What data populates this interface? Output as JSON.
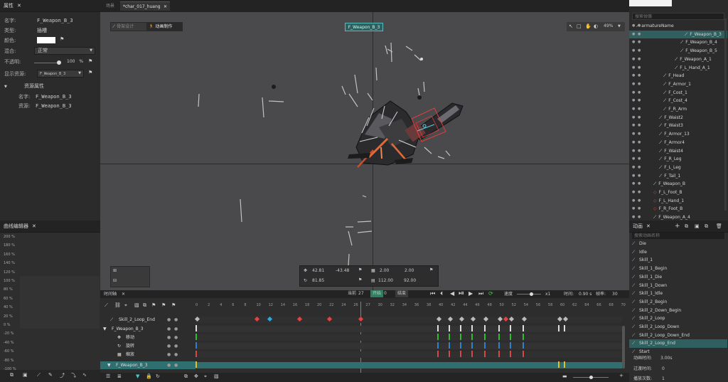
{
  "properties_panel": {
    "title": "属性",
    "name_label": "名字:",
    "name_value": "F_Weapon_B_3",
    "type_label": "类型:",
    "type_value": "插槽",
    "color_label": "颜色:",
    "blend_label": "混合:",
    "blend_value": "正常",
    "opacity_label": "不透明:",
    "opacity_value": "100",
    "opacity_unit": "%",
    "display_label": "显示资源:",
    "display_value": "F_Weapon_B_3",
    "resource_section": "资源属性",
    "res_name_label": "名字:",
    "res_name_value": "F_Weapon_B_3",
    "res_res_label": "资源:",
    "res_res_value": "F_Weapon_B_3"
  },
  "curve_panel": {
    "title": "曲线编辑器",
    "y_labels": [
      "200 %",
      "180 %",
      "160 %",
      "140 %",
      "120 %",
      "100 %",
      "80 %",
      "60 %",
      "40 %",
      "20 %",
      "0 %",
      "-20 %",
      "-40 %",
      "-60 %",
      "-80 %",
      "-100 %"
    ]
  },
  "tabs": {
    "left_tab": "场景",
    "active_tab": "*char_017_huang"
  },
  "viewport": {
    "mode_armature": "骨架设计",
    "mode_animate": "动画制作",
    "selected_label": "F_Weapon_B_3",
    "zoom": "49%",
    "pos_x": "42.81",
    "pos_y": "-43.48",
    "rot": "81.85",
    "scale_x": "2.00",
    "scale_y": "2.00",
    "size_w": "112.00",
    "size_h": "92.00"
  },
  "scene_tree": {
    "search_placeholder": "搜索骨骼",
    "items": [
      {
        "name": "armatureName",
        "indent": 10
      },
      {
        "name": "F_Weapon_B_3",
        "indent": 78,
        "selected": true
      },
      {
        "name": "F_Weapon_B_4",
        "indent": 72
      },
      {
        "name": "F_Weapon_B_5",
        "indent": 72
      },
      {
        "name": "F_Weapon_A_1",
        "indent": 64
      },
      {
        "name": "F_L_Hand_A_1",
        "indent": 64
      },
      {
        "name": "F_Head",
        "indent": 48
      },
      {
        "name": "F_Armor_1",
        "indent": 48
      },
      {
        "name": "F_Cost_1",
        "indent": 48
      },
      {
        "name": "F_Cost_4",
        "indent": 48
      },
      {
        "name": "F_R_Arm",
        "indent": 48
      },
      {
        "name": "F_Waist2",
        "indent": 42
      },
      {
        "name": "F_Waist3",
        "indent": 42
      },
      {
        "name": "F_Armor_13",
        "indent": 42
      },
      {
        "name": "F_Armor4",
        "indent": 42
      },
      {
        "name": "F_Waist4",
        "indent": 42
      },
      {
        "name": "F_R_Leg",
        "indent": 42
      },
      {
        "name": "F_L_Leg",
        "indent": 42
      },
      {
        "name": "F_Tail_1",
        "indent": 42
      },
      {
        "name": "F_Weapon_B",
        "indent": 34
      },
      {
        "name": "F_L_Foot_B",
        "indent": 34,
        "red": true
      },
      {
        "name": "F_L_Hand_1",
        "indent": 34,
        "red": true
      },
      {
        "name": "F_R_Foot_B",
        "indent": 34,
        "red": true
      },
      {
        "name": "F_Weapon_A_4",
        "indent": 34
      }
    ]
  },
  "animation_panel": {
    "title": "动画",
    "search_placeholder": "搜索动画名称",
    "items": [
      "Die",
      "Idle",
      "Skill_1",
      "Skill_1_Begin",
      "Skill_1_Die",
      "Skill_1_Down",
      "Skill_1_Idle",
      "Skill_2_Begin",
      "Skill_2_Down_Begin",
      "Skill_2_Loop",
      "Skill_2_Loop_Down",
      "Skill_2_Loop_Down_End",
      "Skill_2_Loop_End",
      "Start"
    ],
    "selected": "Skill_2_Loop_End",
    "duration_label": "动画时间:",
    "duration_value": "3.00s",
    "transition_label": "过渡时间:",
    "transition_value": "0",
    "loop_label": "播放次数:",
    "loop_value": "1"
  },
  "timeline": {
    "title": "时间轴",
    "current_label": "当前",
    "current_value": "27",
    "start_label": "开始",
    "start_value": "0",
    "end_label": "结束",
    "speed_label": "速度",
    "speed_value": "x1",
    "time_label": "时间:",
    "time_value": "0.90 s",
    "fps_label": "帧率:",
    "fps_value": "30",
    "ticks": [
      "0",
      "2",
      "4",
      "6",
      "8",
      "10",
      "12",
      "14",
      "16",
      "18",
      "20",
      "22",
      "24",
      "26",
      "27",
      "30",
      "32",
      "34",
      "36",
      "38",
      "40",
      "42",
      "44",
      "46",
      "48",
      "50",
      "52",
      "54",
      "56",
      "58",
      "60",
      "62",
      "64",
      "66",
      "68",
      "70"
    ],
    "tracks": [
      {
        "label": "Skill_2_Loop_End"
      },
      {
        "label": "F_Weapon_B_3"
      },
      {
        "label": "移动"
      },
      {
        "label": "旋转"
      },
      {
        "label": "缩放"
      },
      {
        "label": "F_Weapon_B_3"
      }
    ]
  },
  "colors": {
    "accent": "#2f7f7f",
    "keyframe_red": "#e04545",
    "keyframe_blue": "#2fa8e0",
    "playhead": "#27c227"
  }
}
